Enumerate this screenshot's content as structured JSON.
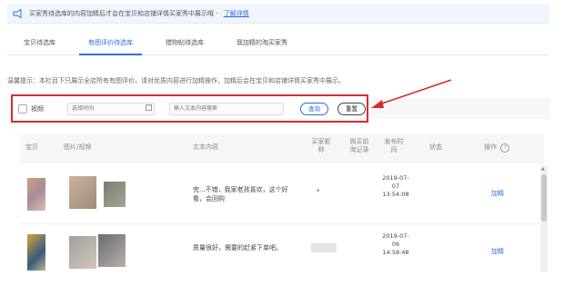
{
  "notice": {
    "text": "买家秀待选库的内容加精后才会在宝贝和店铺详情买家秀中展示哦 - ",
    "link": "了解详情"
  },
  "tabs": [
    {
      "label": "宝贝待选库"
    },
    {
      "label": "有图评价待选库"
    },
    {
      "label": "猎物帖待选库"
    },
    {
      "label": "我加精的淘买家秀"
    }
  ],
  "tip": "温馨提示：本栏目下只展示全店所有有图评价，请对优质内容进行加精操作，加精后会在宝贝和店铺详情买家秀中展示。",
  "filter": {
    "video_label": "视频",
    "date_placeholder": "选择时间",
    "keyword_placeholder": "输入文本内容搜索",
    "search_label": "查询",
    "reset_label": "重置"
  },
  "table": {
    "headers": {
      "item": "宝贝",
      "media": "图片/视频",
      "text": "文本内容",
      "buyer": "买家昵称",
      "purchase": "购买前淘记录",
      "time": "发布时间",
      "status": "状态",
      "action": "操作"
    },
    "rows": [
      {
        "text": "完...不错，我家老孩喜欢，这个好看，会回购",
        "buyer": "*",
        "time": "2019-07-07 13:54:08",
        "action": "加精"
      },
      {
        "text": "质量很好，需要的赶紧下单吧。",
        "buyer": "",
        "time": "2019-07-06 14:58:48",
        "action": "加精"
      }
    ]
  }
}
